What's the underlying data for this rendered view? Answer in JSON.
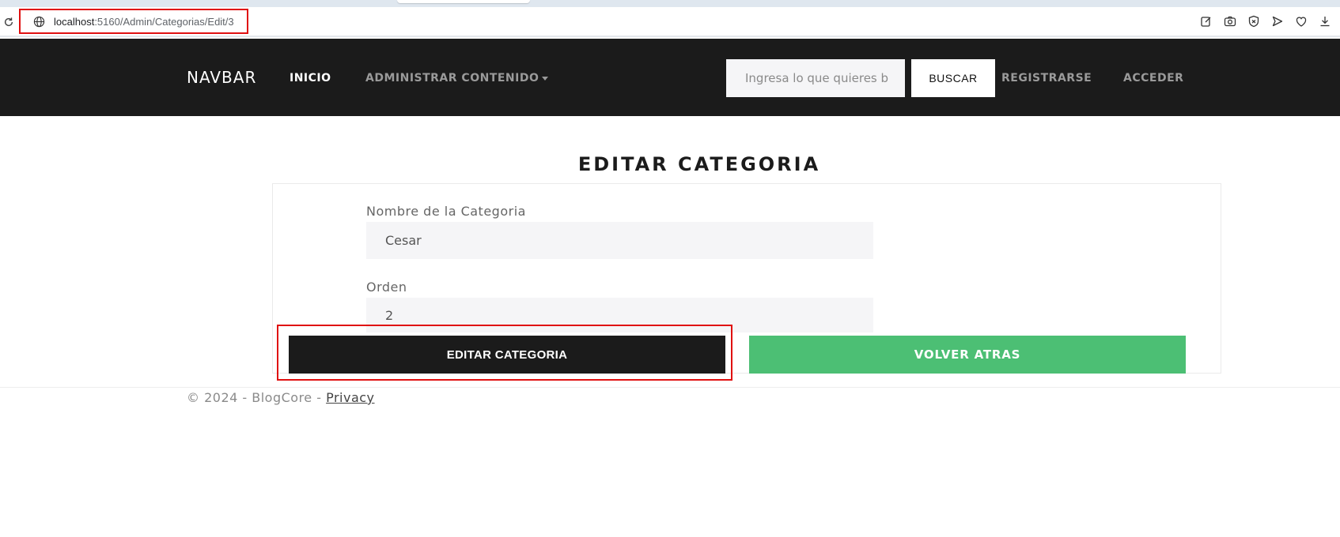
{
  "browser": {
    "url_host": "localhost",
    "url_path": ":5160/Admin/Categorias/Edit/3",
    "icons": [
      "reload-icon",
      "globe-icon",
      "edit-icon",
      "camera-icon",
      "shield-icon",
      "send-icon",
      "heart-icon",
      "download-icon"
    ]
  },
  "navbar": {
    "brand": "NAVBAR",
    "inicio": "INICIO",
    "administrar": "ADMINISTRAR CONTENIDO",
    "search_placeholder": "Ingresa lo que quieres b",
    "search_button": "BUSCAR",
    "registrarse": "REGISTRARSE",
    "acceder": "ACCEDER"
  },
  "form": {
    "title": "EDITAR CATEGORIA",
    "nombre_label": "Nombre de la Categoria",
    "nombre_value": "Cesar",
    "orden_label": "Orden",
    "orden_value": "2",
    "submit_label": "EDITAR CATEGORIA",
    "back_label": "VOLVER ATRAS"
  },
  "footer": {
    "copyright": "© 2024 - BlogCore - ",
    "privacy": "Privacy"
  },
  "colors": {
    "navbar_bg": "#1b1b1b",
    "back_button": "#4cbf74",
    "highlight": "#e01010"
  }
}
